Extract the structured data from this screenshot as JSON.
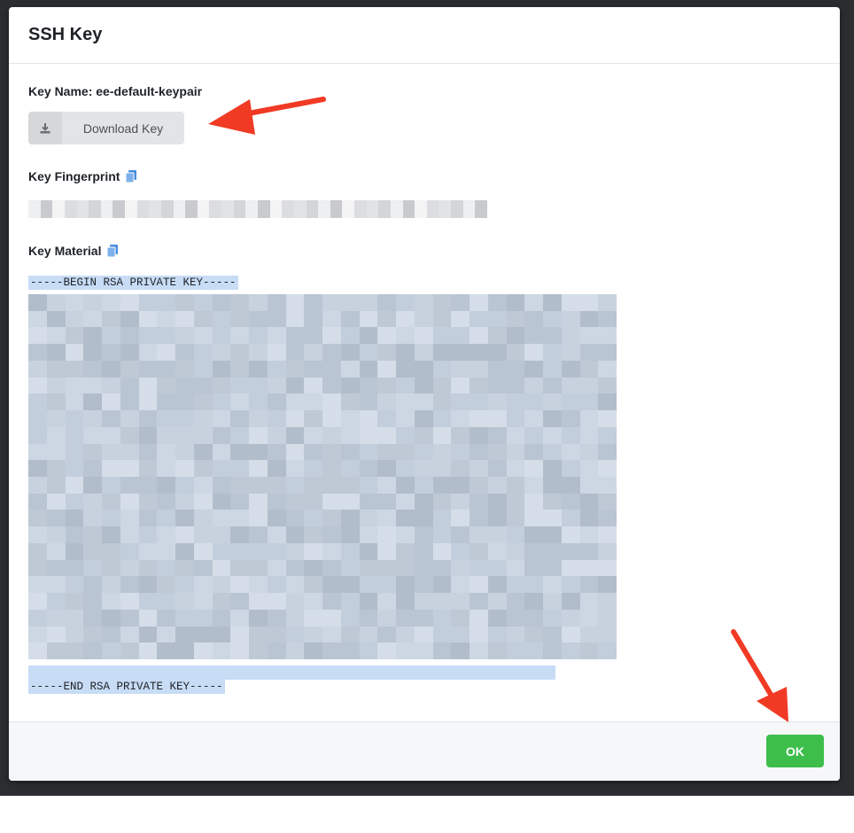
{
  "modal": {
    "title": "SSH Key",
    "key_name_label": "Key Name: ee-default-keypair",
    "download_button_label": "Download Key",
    "fingerprint_label": "Key Fingerprint",
    "material_label": "Key Material",
    "key_begin": "-----BEGIN RSA PRIVATE KEY-----",
    "key_end": "-----END RSA PRIVATE KEY-----",
    "ok_button_label": "OK"
  },
  "colors": {
    "ok_green": "#3dbe4b",
    "copy_icon_blue": "#4a8fe0",
    "annotation_arrow_red": "#f03a24",
    "selection_highlight": "#c8dcf5"
  },
  "icons": {
    "download": "download-icon",
    "copy": "copy-icon"
  }
}
